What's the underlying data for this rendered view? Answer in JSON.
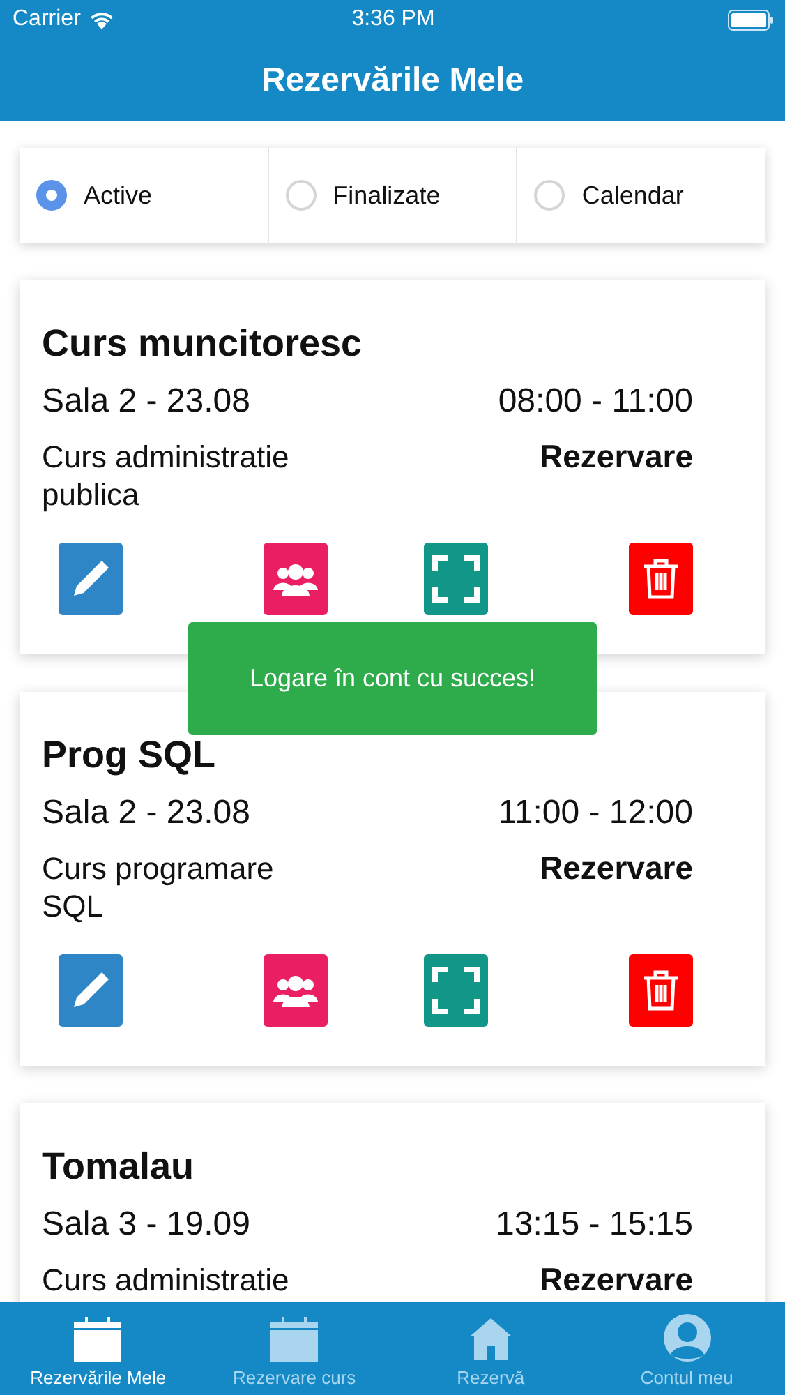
{
  "status_bar": {
    "carrier": "Carrier",
    "time": "3:36 PM"
  },
  "header": {
    "title": "Rezervările Mele"
  },
  "filters": [
    {
      "label": "Active",
      "selected": true
    },
    {
      "label": "Finalizate",
      "selected": false
    },
    {
      "label": "Calendar",
      "selected": false
    }
  ],
  "bookings": [
    {
      "title": "Curs muncitoresc",
      "room": "Sala 2 - 23.08",
      "time": "08:00 - 11:00",
      "description": "Curs administratie publica",
      "status": "Rezervare"
    },
    {
      "title": "Prog SQL",
      "room": "Sala 2 - 23.08",
      "time": "11:00 - 12:00",
      "description": "Curs programare SQL",
      "status": "Rezervare"
    },
    {
      "title": "Tomalau",
      "room": "Sala 3 - 19.09",
      "time": "13:15 - 15:15",
      "description": "Curs administratie",
      "status": "Rezervare"
    }
  ],
  "toast": {
    "message": "Logare în cont cu succes!"
  },
  "tab_bar": [
    {
      "label": "Rezervările Mele",
      "kind": "calendar",
      "selected": true
    },
    {
      "label": "Rezervare curs",
      "kind": "calendar",
      "selected": false
    },
    {
      "label": "Rezervă",
      "kind": "home",
      "selected": false
    },
    {
      "label": "Contul meu",
      "kind": "user",
      "selected": false
    }
  ]
}
